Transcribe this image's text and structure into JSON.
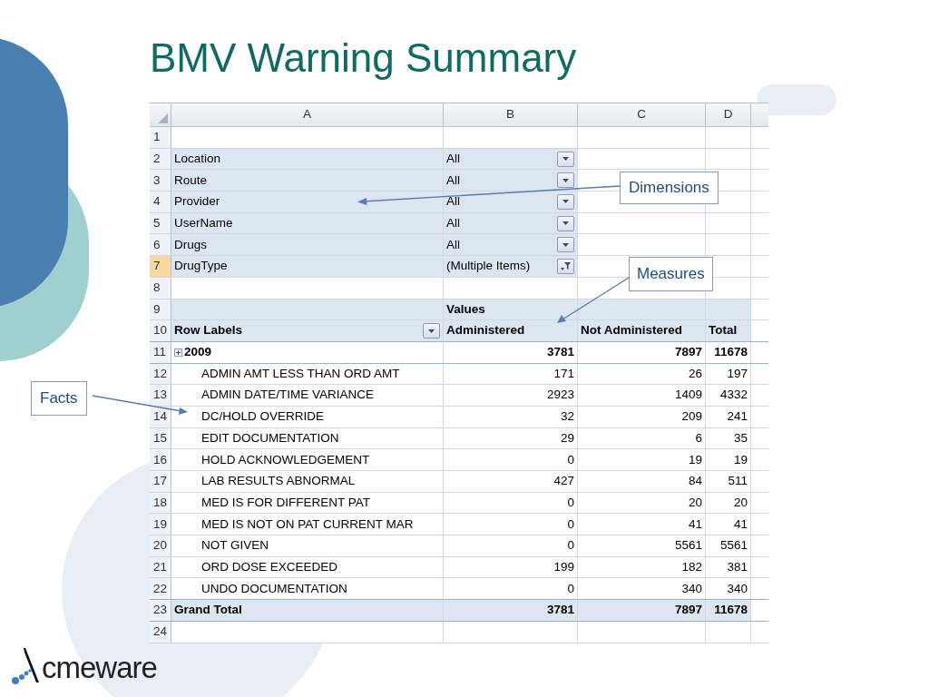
{
  "title": "BMV Warning Summary",
  "sheet": {
    "columns": [
      "A",
      "B",
      "C",
      "D"
    ],
    "row_headers": [
      {
        "label": "1",
        "selected": false
      },
      {
        "label": "2",
        "selected": false
      },
      {
        "label": "3",
        "selected": false
      },
      {
        "label": "4",
        "selected": false
      },
      {
        "label": "5",
        "selected": false
      },
      {
        "label": "6",
        "selected": false
      },
      {
        "label": "7",
        "selected": true
      },
      {
        "label": "8",
        "selected": false
      },
      {
        "label": "9",
        "selected": false
      },
      {
        "label": "10",
        "selected": false
      },
      {
        "label": "11",
        "selected": false
      },
      {
        "label": "12",
        "selected": false
      },
      {
        "label": "13",
        "selected": false
      },
      {
        "label": "14",
        "selected": false
      },
      {
        "label": "15",
        "selected": false
      },
      {
        "label": "16",
        "selected": false
      },
      {
        "label": "17",
        "selected": false
      },
      {
        "label": "18",
        "selected": false
      },
      {
        "label": "19",
        "selected": false
      },
      {
        "label": "20",
        "selected": false
      },
      {
        "label": "21",
        "selected": false
      },
      {
        "label": "22",
        "selected": false
      },
      {
        "label": "23",
        "selected": false
      },
      {
        "label": "24",
        "selected": false
      }
    ],
    "filters": [
      {
        "label": "Location",
        "value": "All",
        "kind": "dropdown"
      },
      {
        "label": "Route",
        "value": "All",
        "kind": "dropdown"
      },
      {
        "label": "Provider",
        "value": "All",
        "kind": "dropdown"
      },
      {
        "label": "UserName",
        "value": "All",
        "kind": "dropdown"
      },
      {
        "label": "Drugs",
        "value": "All",
        "kind": "dropdown"
      },
      {
        "label": "DrugType",
        "value": "(Multiple Items)",
        "kind": "filtered"
      }
    ],
    "values_caption": "Values",
    "row_labels_header": "Row Labels",
    "measure_headers": [
      "Administered",
      "Not Administered",
      "Total"
    ],
    "group": {
      "label": "2009",
      "values": [
        "3781",
        "7897",
        "11678"
      ]
    },
    "items": [
      {
        "label": "ADMIN AMT LESS THAN ORD AMT",
        "values": [
          "171",
          "26",
          "197"
        ]
      },
      {
        "label": "ADMIN DATE/TIME VARIANCE",
        "values": [
          "2923",
          "1409",
          "4332"
        ]
      },
      {
        "label": "DC/HOLD OVERRIDE",
        "values": [
          "32",
          "209",
          "241"
        ]
      },
      {
        "label": "EDIT DOCUMENTATION",
        "values": [
          "29",
          "6",
          "35"
        ]
      },
      {
        "label": "HOLD ACKNOWLEDGEMENT",
        "values": [
          "0",
          "19",
          "19"
        ]
      },
      {
        "label": "LAB RESULTS ABNORMAL",
        "values": [
          "427",
          "84",
          "511"
        ]
      },
      {
        "label": "MED IS FOR DIFFERENT PAT",
        "values": [
          "0",
          "20",
          "20"
        ]
      },
      {
        "label": "MED IS NOT ON PAT CURRENT MAR",
        "values": [
          "0",
          "41",
          "41"
        ]
      },
      {
        "label": "NOT GIVEN",
        "values": [
          "0",
          "5561",
          "5561"
        ]
      },
      {
        "label": "ORD DOSE EXCEEDED",
        "values": [
          "199",
          "182",
          "381"
        ]
      },
      {
        "label": "UNDO DOCUMENTATION",
        "values": [
          "0",
          "340",
          "340"
        ]
      }
    ],
    "grand_total": {
      "label": "Grand Total",
      "values": [
        "3781",
        "7897",
        "11678"
      ]
    }
  },
  "callouts": [
    {
      "text": "Dimensions"
    },
    {
      "text": "Measures"
    },
    {
      "text": "Facts"
    }
  ],
  "logo": {
    "text": "cmeware"
  }
}
